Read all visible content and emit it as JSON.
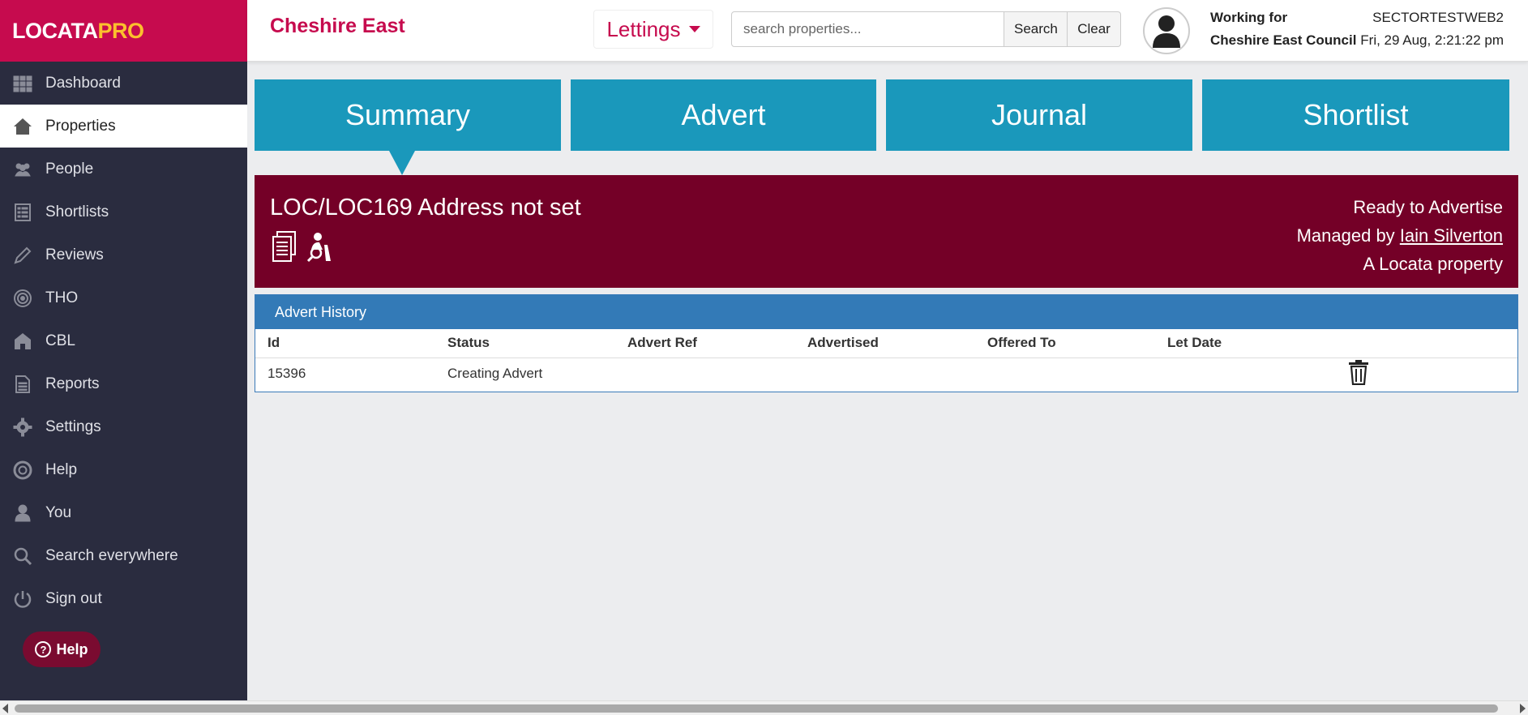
{
  "brand": {
    "logo_main": "LOCATA",
    "logo_pro": "PRO"
  },
  "sidebar": {
    "items": [
      {
        "label": "Dashboard",
        "icon": "grid-icon"
      },
      {
        "label": "Properties",
        "icon": "house-icon"
      },
      {
        "label": "People",
        "icon": "people-icon"
      },
      {
        "label": "Shortlists",
        "icon": "list-icon"
      },
      {
        "label": "Reviews",
        "icon": "pencil-icon"
      },
      {
        "label": "THO",
        "icon": "target-icon"
      },
      {
        "label": "CBL",
        "icon": "home-icon"
      },
      {
        "label": "Reports",
        "icon": "document-icon"
      },
      {
        "label": "Settings",
        "icon": "gear-icon"
      },
      {
        "label": "Help",
        "icon": "lifebuoy-icon"
      },
      {
        "label": "You",
        "icon": "user-icon"
      },
      {
        "label": "Search everywhere",
        "icon": "search-icon"
      },
      {
        "label": "Sign out",
        "icon": "power-icon"
      }
    ],
    "active": "Properties",
    "help_button": "Help"
  },
  "header": {
    "org": "Cheshire East",
    "module": "Lettings",
    "search_placeholder": "search properties...",
    "search_button": "Search",
    "clear_button": "Clear",
    "working_for_label": "Working for",
    "working_for_org": "Cheshire East Council",
    "environment": "SECTORTESTWEB2",
    "datetime": "Fri, 29 Aug, 2:21:22 pm"
  },
  "tabs": [
    {
      "label": "Summary"
    },
    {
      "label": "Advert"
    },
    {
      "label": "Journal"
    },
    {
      "label": "Shortlist"
    }
  ],
  "property": {
    "title": "LOC/LOC169 Address not set",
    "status": "Ready to Advertise",
    "managed_by_label": "Managed by",
    "managed_by_name": "Iain Silverton",
    "owner": "A Locata property"
  },
  "advert_history": {
    "title": "Advert History",
    "columns": [
      "Id",
      "Status",
      "Advert Ref",
      "Advertised",
      "Offered To",
      "Let Date"
    ],
    "rows": [
      {
        "id": "15396",
        "status": "Creating Advert",
        "advert_ref": "",
        "advertised": "",
        "offered_to": "",
        "let_date": ""
      }
    ]
  },
  "colors": {
    "brand": "#c60b4e",
    "sidebar": "#2a2c3f",
    "tab": "#1a98bb",
    "banner": "#740027",
    "panel_head": "#337ab7"
  }
}
